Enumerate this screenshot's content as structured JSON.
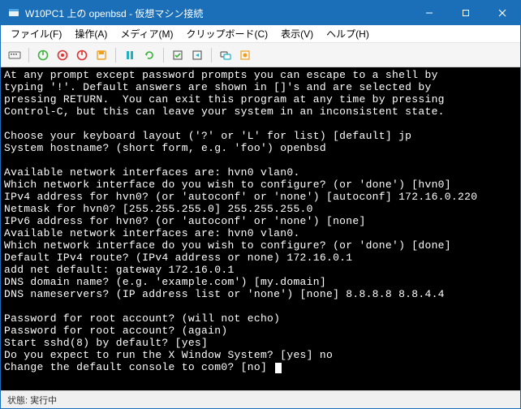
{
  "window": {
    "title": "W10PC1 上の openbsd - 仮想マシン接続",
    "min": "—",
    "max": "☐",
    "close": "✕"
  },
  "menu": {
    "file": "ファイル(F)",
    "action": "操作(A)",
    "media": "メディア(M)",
    "clipboard": "クリップボード(C)",
    "view": "表示(V)",
    "help": "ヘルプ(H)"
  },
  "terminal_lines": [
    "At any prompt except password prompts you can escape to a shell by",
    "typing '!'. Default answers are shown in []'s and are selected by",
    "pressing RETURN.  You can exit this program at any time by pressing",
    "Control-C, but this can leave your system in an inconsistent state.",
    "",
    "Choose your keyboard layout ('?' or 'L' for list) [default] jp",
    "System hostname? (short form, e.g. 'foo') openbsd",
    "",
    "Available network interfaces are: hvn0 vlan0.",
    "Which network interface do you wish to configure? (or 'done') [hvn0]",
    "IPv4 address for hvn0? (or 'autoconf' or 'none') [autoconf] 172.16.0.220",
    "Netmask for hvn0? [255.255.255.0] 255.255.255.0",
    "IPv6 address for hvn0? (or 'autoconf' or 'none') [none]",
    "Available network interfaces are: hvn0 vlan0.",
    "Which network interface do you wish to configure? (or 'done') [done]",
    "Default IPv4 route? (IPv4 address or none) 172.16.0.1",
    "add net default: gateway 172.16.0.1",
    "DNS domain name? (e.g. 'example.com') [my.domain]",
    "DNS nameservers? (IP address list or 'none') [none] 8.8.8.8 8.8.4.4",
    "",
    "Password for root account? (will not echo)",
    "Password for root account? (again)",
    "Start sshd(8) by default? [yes]",
    "Do you expect to run the X Window System? [yes] no",
    "Change the default console to com0? [no]"
  ],
  "status": {
    "label": "状態:",
    "value": "実行中"
  },
  "colors": {
    "accent": "#1a6fb8",
    "green": "#3bb33b",
    "red": "#e03030",
    "orange": "#f0a020",
    "cyan": "#20b0c0"
  }
}
